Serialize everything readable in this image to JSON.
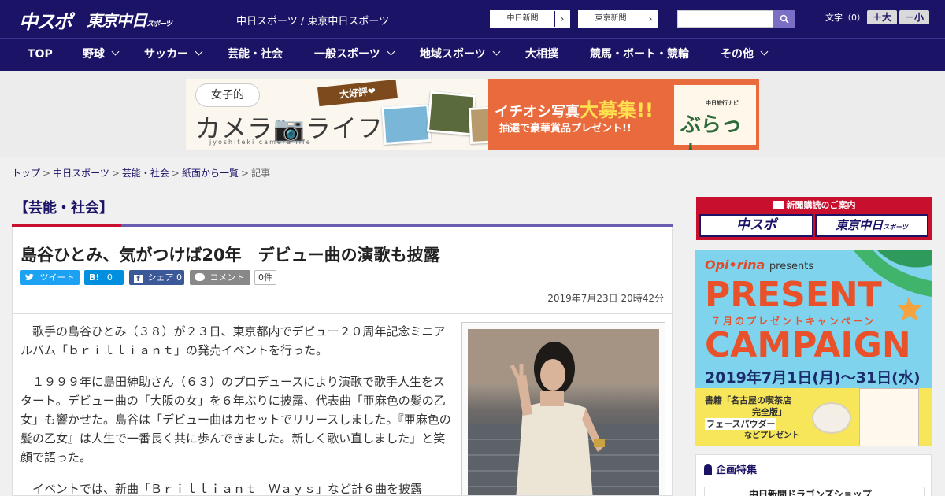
{
  "header": {
    "logo_chuspo": "中スポ",
    "logo_tokyo": "東京中日",
    "logo_tokyo_small": "スポーツ",
    "site_title": "中日スポーツ / 東京中日スポーツ",
    "ext_links": [
      {
        "label": "中日新聞"
      },
      {
        "label": "東京新聞"
      }
    ],
    "search_placeholder": "",
    "font_size_label": "文字（0）",
    "font_larger": "＋大",
    "font_smaller": "－小"
  },
  "nav": {
    "items": [
      {
        "label": "TOP"
      },
      {
        "label": "野球"
      },
      {
        "label": "サッカー"
      },
      {
        "label": "芸能・社会"
      },
      {
        "label": "一般スポーツ"
      },
      {
        "label": "地域スポーツ"
      },
      {
        "label": "大相撲"
      },
      {
        "label": "競馬・ボート・競輪"
      },
      {
        "label": "その他"
      }
    ]
  },
  "banner": {
    "tag": "女子的",
    "title": "カメラ📷ライフ",
    "subtitle": "jyoshiteki camera life",
    "ribbon": "大好評❤",
    "main_text_1": "イチオシ写真",
    "main_text_big": "大募集!!",
    "prize": "抽選で豪華賞品プレゼント!!",
    "brand_small": "中日旅行ナビ",
    "brand_big": "ぶらっ人"
  },
  "breadcrumb": {
    "items": [
      "トップ",
      "中日スポーツ",
      "芸能・社会",
      "紙面から一覧"
    ],
    "current": "記事",
    "separator": ">"
  },
  "article": {
    "category": "【芸能・社会】",
    "headline": "島谷ひとみ、気がつけば20年　デビュー曲の演歌も披露",
    "share": {
      "tweet": "ツイート",
      "hatena": "0",
      "facebook": "シェア 0",
      "comment": "コメント",
      "comment_count": "0件"
    },
    "date": "2019年7月23日 20時42分",
    "paragraphs": [
      "　歌手の島谷ひとみ（３８）が２３日、東京都内でデビュー２０周年記念ミニアルバム「ｂｒｉｌｌｉａｎｔ」の発売イベントを行った。",
      "　１９９９年に島田紳助さん（６３）のプロデュースにより演歌で歌手人生をスタート。デビュー曲の「大阪の女」を６年ぶりに披露、代表曲「亜麻色の髪の乙女」も響かせた。島谷は「デビュー曲はカセットでリリースしました。『亜麻色の髪の乙女』は人生で一番長く共に歩んできました。新しく歌い直しました」と笑顔で語った。",
      "　イベントでは、新曲「Ｂｒｉｌｌｉａｎｔ　Ｗａｙｓ」など計６曲を披露"
    ]
  },
  "sidebar": {
    "subscribe_title": "新聞購読のご案内",
    "subscribe_items": [
      "中スポ",
      "東京中日"
    ],
    "subscribe_small": "スポーツ",
    "present": {
      "brand": "Opi•rina",
      "brand_suffix": "presents",
      "line1": "PRESENT",
      "sub": "７月のプレゼントキャンペーン",
      "line2": "CAMPAIGN",
      "date": "2019年7月1日(月)〜31日(水)",
      "book_line1": "書籍「名古屋の喫茶店",
      "book_line2": "完全版」",
      "book_line3": "フェースパウダー",
      "book_line4": "などプレゼント"
    },
    "feature_title": "企画特集",
    "feature_item": "中日新聞ドラゴンズショップ"
  },
  "colors": {
    "brand_navy": "#1b1366",
    "accent_red": "#c8102e",
    "accent_purple": "#6a5cae",
    "twitter": "#1da1f2",
    "hatena": "#008fde",
    "facebook": "#3b5998",
    "comment": "#888888"
  }
}
